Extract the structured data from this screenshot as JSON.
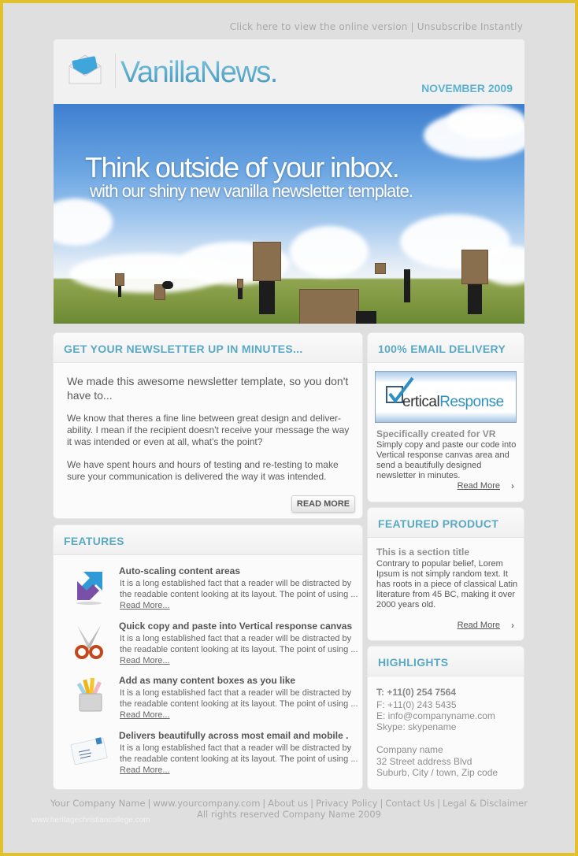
{
  "top_links": {
    "online_version": "Click here to view the online version",
    "separator": "|",
    "unsubscribe": "Unsubscribe Instantly"
  },
  "header": {
    "logo_text": "VanillaNews.",
    "date": "NOVEMBER 2009",
    "logo_icon": "envelope-icon"
  },
  "hero": {
    "title": "Think outside of your inbox.",
    "subtitle": "with our shiny new vanilla newsletter template."
  },
  "intro": {
    "heading": "GET YOUR NEWSLETTER UP IN MINUTES...",
    "lead": "We made this awesome newsletter template, so you don't have to...",
    "paragraph1": "We know that theres a fine line between great design and deliver-ability. I mean if the recipient doesn't receive your message the way it was intended or even at all, what's the point?",
    "paragraph2": "We have spent hours and hours of testing and re-testing to make sure your communication is delivered the way it was intended.",
    "button": "READ MORE"
  },
  "features": {
    "heading": "FEATURES",
    "items": [
      {
        "title": "Auto-scaling content areas",
        "body": "It is a long established fact that a reader will be distracted by the readable content looking at its layout. The point of using ...",
        "link": "Read More...",
        "icon": "resize-arrows-icon"
      },
      {
        "title": "Quick copy and paste into Vertical response canvas",
        "body": "It is a long established fact that a reader will be distracted by the readable content looking at its layout. The point of using ...",
        "link": "Read More...",
        "icon": "scissors-icon"
      },
      {
        "title": "Add as many content boxes as you like",
        "body": "It is a long established fact that a reader will be distracted by the readable content looking at its layout. The point of using ...",
        "link": "Read More...",
        "icon": "pencil-cup-icon"
      },
      {
        "title": "Delivers beautifully across most email and mobile .",
        "body": "It is a long established fact that a reader will be distracted by the readable content looking at its layout. The point of using ...",
        "link": "Read More...",
        "icon": "postcard-icon"
      }
    ]
  },
  "email_delivery": {
    "heading": "100% EMAIL DELIVERY",
    "logo_part1": "ertical",
    "logo_part2": "Response",
    "subtitle": "Specifically created for VR",
    "body": "Simply copy and paste our code into Vertical response canvas area and send a beautifully designed newsletter in minutes.",
    "link": "Read More",
    "chevron": "›"
  },
  "featured_product": {
    "heading": "FEATURED PRODUCT",
    "subtitle": "This is a section title",
    "body": "Contrary to popular belief, Lorem Ipsum is not simply random text. It has roots in a piece of classical Latin literature from 45 BC, making it over 2000 years old.",
    "link": "Read More",
    "chevron": "›"
  },
  "highlights": {
    "heading": "HIGHLIGHTS",
    "phone": "T: +11(0) 254 7564",
    "fax": "F: +11(0) 243 5435",
    "email": "E: info@companyname.com",
    "skype": "Skype: skypename",
    "company": "Company name",
    "street": "32 Street address Blvd",
    "city": "Suburb, City / town, Zip code"
  },
  "footer": {
    "links": [
      "Your Company Name",
      "www.yourcompany.com",
      "About us",
      "Privacy Policy",
      "Contact Us",
      "Legal & Disclaimer"
    ],
    "separator": "|",
    "copyright": "All rights reserved Company Name 2009"
  },
  "watermark": "www.heritagechristiancollege.com",
  "colors": {
    "accent": "#5aa9c4",
    "frame_border": "#e2c12e",
    "background": "#dfdfdf"
  }
}
